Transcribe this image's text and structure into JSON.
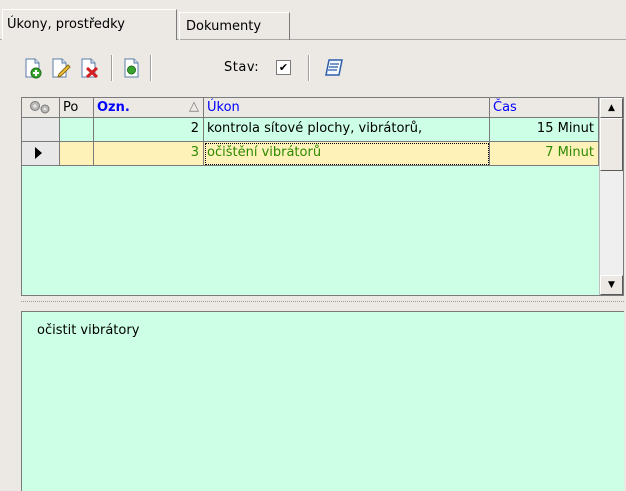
{
  "tabs": [
    {
      "label": "Úkony, prostředky",
      "active": true
    },
    {
      "label": "Dokumenty",
      "active": false
    }
  ],
  "toolbar": {
    "buttons": [
      "new-icon",
      "edit-icon",
      "delete-icon",
      "document-icon",
      "print-icon"
    ],
    "stav_label": "Stav:",
    "stav_checked": true
  },
  "grid": {
    "columns": [
      "",
      "Po",
      "Ozn.",
      "Úkon",
      "Čas"
    ],
    "sort_indicator": "△",
    "rows": [
      {
        "po": "",
        "ozn": "2",
        "ukon": "kontrola sítové plochy,  vibrátorů,",
        "cas": "15 Minut",
        "selected": false
      },
      {
        "po": "",
        "ozn": "3",
        "ukon": "očištění vibrátorů",
        "cas": "7 Minut",
        "selected": true
      }
    ]
  },
  "note": {
    "text": "očistit vibrátory"
  },
  "colors": {
    "grid_bg": "#ccffe5",
    "selected_row_bg": "#fef2b8",
    "selected_text": "#2d8a00",
    "header_link": "#0000ff"
  }
}
